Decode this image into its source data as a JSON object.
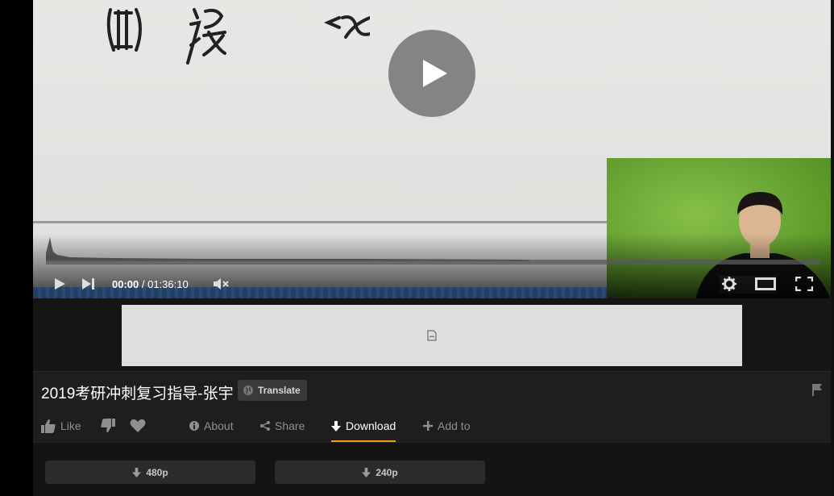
{
  "player": {
    "current_time": "00:00",
    "separator": " / ",
    "duration": "01:36:10"
  },
  "video": {
    "title": "2019考研冲刺复习指导-张宇",
    "translate_label": "Translate"
  },
  "actions": {
    "like": "Like",
    "about": "About",
    "share": "Share",
    "download": "Download",
    "add_to": "Add to"
  },
  "downloads": [
    {
      "label": "480p"
    },
    {
      "label": "240p"
    }
  ],
  "colors": {
    "accent": "#f39c12",
    "background": "#1e1e1e",
    "button": "#2b2b2b"
  },
  "icons": {
    "big_play": "play-icon",
    "play": "play-icon",
    "next": "skip-next-icon",
    "mute": "volume-muted-icon",
    "settings": "gear-icon",
    "theater": "theater-mode-icon",
    "fullscreen": "fullscreen-icon",
    "flag": "flag-icon",
    "download": "arrow-down-icon"
  }
}
